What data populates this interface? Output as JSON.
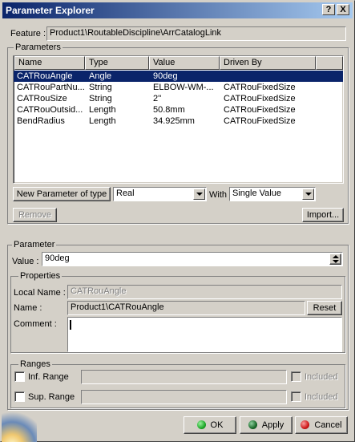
{
  "window": {
    "title": "Parameter Explorer",
    "help_label": "?",
    "close_label": "X"
  },
  "feature": {
    "label": "Feature :",
    "value": "Product1\\RoutableDiscipline\\ArrCatalogLink"
  },
  "parameters_group": {
    "title": "Parameters",
    "columns": [
      "Name",
      "Type",
      "Value",
      "Driven By"
    ],
    "rows": [
      {
        "name": "CATRouAngle",
        "type": "Angle",
        "value": "90deg",
        "driven_by": ""
      },
      {
        "name": "CATRouPartNu...",
        "type": "String",
        "value": "ELBOW-WM-...",
        "driven_by": "CATRouFixedSize"
      },
      {
        "name": "CATRouSize",
        "type": "String",
        "value": "2''",
        "driven_by": "CATRouFixedSize"
      },
      {
        "name": "CATRouOutsid...",
        "type": "Length",
        "value": "50.8mm",
        "driven_by": "CATRouFixedSize"
      },
      {
        "name": "BendRadius",
        "type": "Length",
        "value": "34.925mm",
        "driven_by": "CATRouFixedSize"
      }
    ],
    "new_param_button": "New Parameter of type",
    "type_select": "Real",
    "with_label": "With",
    "value_kind_select": "Single Value",
    "remove_button": "Remove",
    "import_button": "Import..."
  },
  "parameter_group": {
    "title": "Parameter",
    "value_label": "Value :",
    "value": "90deg"
  },
  "properties_group": {
    "title": "Properties",
    "local_name_label": "Local Name :",
    "local_name_value": "CATRouAngle",
    "name_label": "Name :",
    "name_value": "Product1\\CATRouAngle",
    "reset_button": "Reset",
    "comment_label": "Comment :",
    "comment_value": ""
  },
  "ranges_group": {
    "title": "Ranges",
    "inf_label": "Inf. Range",
    "sup_label": "Sup. Range",
    "included_label": "Included"
  },
  "footer": {
    "ok_label": "OK",
    "apply_label": "Apply",
    "cancel_label": "Cancel"
  },
  "colors": {
    "selection": "#0a246a",
    "ok_dot": "#1faa2a",
    "apply_dot": "#1a6a2a",
    "cancel_dot": "#d01818"
  }
}
